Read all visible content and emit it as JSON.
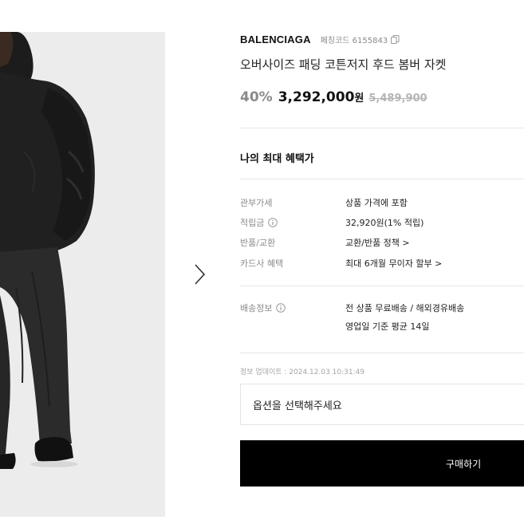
{
  "product": {
    "brand": "BALENCIAGA",
    "code_label": "페칭코드 6155843",
    "name": "오버사이즈 패딩 코튼저지 후드 봄버 자켓",
    "discount": "40%",
    "price": "3,292,000",
    "currency": "원",
    "original_price": "5,489,900"
  },
  "benefit": {
    "title": "나의 최대 혜택가",
    "rows": [
      {
        "label": "관부가세",
        "value": "상품 가격에 포함"
      },
      {
        "label": "적립금",
        "value": "32,920원(1% 적립)"
      },
      {
        "label": "반품/교환",
        "value": "교환/반품 정책 >"
      },
      {
        "label": "카드사 혜택",
        "value": "최대 6개월 무이자 할부 >"
      }
    ]
  },
  "shipping": {
    "label": "배송정보",
    "line1": "전 상품 무료배송 / 해외경유배송",
    "line2": "영업일 기준 평균 14일"
  },
  "updated": "정보 업데이트 : 2024.12.03 10:31:49",
  "option_placeholder": "옵션을 선택해주세요",
  "buy_label": "구매하기",
  "colors": {
    "buy_button": "#000000",
    "muted_text": "#8a8a8a",
    "strike_price": "#b5b5b5"
  },
  "icons": [
    "copy-icon",
    "info-icon",
    "chevron-right-icon"
  ]
}
